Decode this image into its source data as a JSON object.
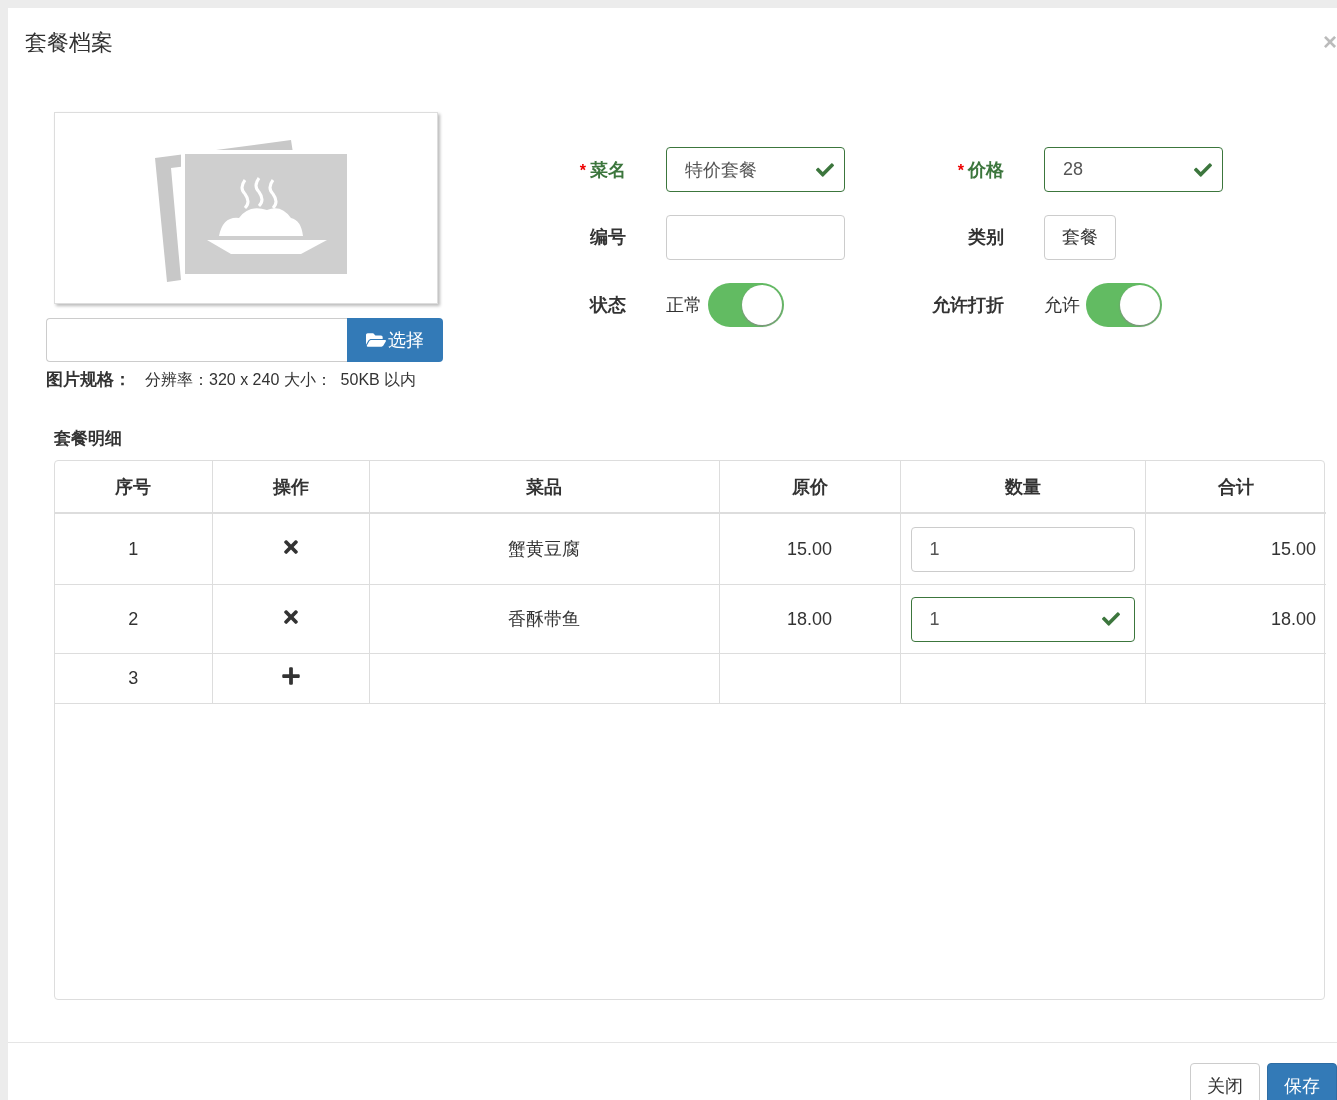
{
  "dialog": {
    "title": "套餐档案",
    "close": "×"
  },
  "image": {
    "choose_button": "选择",
    "spec_label": "图片规格：",
    "spec_text": "分辨率：320 x 240 大小：  50KB 以内"
  },
  "form": {
    "required_mark": "*",
    "fields": [
      {
        "kind": "input",
        "label": "菜名",
        "required": true,
        "value": "特价套餐",
        "valid": true
      },
      {
        "kind": "input",
        "label": "价格",
        "required": true,
        "value": "28",
        "valid": true
      },
      {
        "kind": "input",
        "label": "编号",
        "required": false,
        "valid": false
      },
      {
        "kind": "picker",
        "label": "类别",
        "required": false,
        "value": "套餐",
        "valid": false
      },
      {
        "kind": "switch",
        "label": "状态",
        "required": false,
        "value": "正常",
        "on": true
      },
      {
        "kind": "switch",
        "label": "允许打折",
        "required": false,
        "value": "允许",
        "on": true
      }
    ]
  },
  "details": {
    "title": "套餐明细",
    "columns": [
      "序号",
      "操作",
      "菜品",
      "原价",
      "数量",
      "合计"
    ],
    "rows": [
      {
        "kind": "item",
        "index": "1",
        "dish": "蟹黄豆腐",
        "price": "15.00",
        "quantity": "1",
        "quantity_valid": false,
        "total": "15.00"
      },
      {
        "kind": "item",
        "index": "2",
        "dish": "香酥带鱼",
        "price": "18.00",
        "quantity": "1",
        "quantity_valid": true,
        "total": "18.00"
      },
      {
        "kind": "add",
        "index": "3"
      }
    ]
  },
  "footer": {
    "buttons": [
      {
        "label": "关闭",
        "primary": false
      },
      {
        "label": "保存",
        "primary": true
      }
    ]
  }
}
